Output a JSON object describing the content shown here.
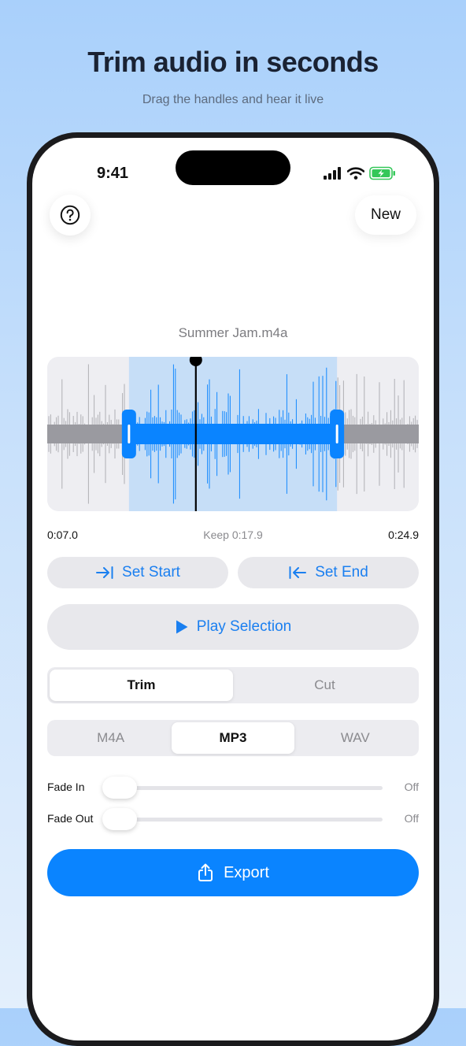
{
  "hero": {
    "title": "Trim audio in seconds",
    "subtitle": "Drag the handles and hear it live"
  },
  "status_bar": {
    "time": "9:41",
    "icons": [
      "cellular-signal-icon",
      "wifi-icon",
      "battery-charging-icon"
    ]
  },
  "toolbar": {
    "help_icon": "question-mark-icon",
    "new_label": "New"
  },
  "file": {
    "name": "Summer Jam.m4a"
  },
  "waveform": {
    "selection_start_fraction": 0.22,
    "selection_end_fraction": 0.78,
    "playhead_fraction": 0.4,
    "colors": {
      "selected_wave": "#0a84ff",
      "selection_bg": "#c6def7",
      "unselected_wave": "#9a9aa0",
      "box_bg": "#eeeef2"
    }
  },
  "times": {
    "start": "0:07.0",
    "keep": "Keep 0:17.9",
    "end": "0:24.9"
  },
  "actions": {
    "set_start_label": "Set Start",
    "set_end_label": "Set End",
    "play_label": "Play Selection"
  },
  "mode": {
    "options": [
      "Trim",
      "Cut"
    ],
    "selected": "Trim"
  },
  "format": {
    "options": [
      "M4A",
      "MP3",
      "WAV"
    ],
    "selected": "MP3"
  },
  "fades": {
    "fade_in_label": "Fade In",
    "fade_in_value": "Off",
    "fade_out_label": "Fade Out",
    "fade_out_value": "Off"
  },
  "export": {
    "label": "Export",
    "color": "#0a84ff"
  },
  "accent_color": "#1a7ff0"
}
